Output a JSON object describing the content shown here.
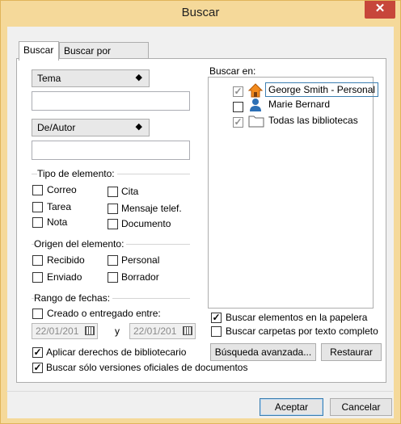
{
  "window": {
    "title": "Buscar",
    "close_glyph": "✕",
    "colors": {
      "frame": "#f5d99a",
      "close": "#c7463a",
      "accent": "#3c7fb1"
    }
  },
  "tabs": [
    {
      "label": "Buscar",
      "active": true
    },
    {
      "label": "Buscar por ejemplo",
      "active": false
    }
  ],
  "fields": {
    "field1": {
      "label": "Tema",
      "value": ""
    },
    "field2": {
      "label": "De/Autor",
      "value": ""
    }
  },
  "item_type": {
    "label": "Tipo de elemento:",
    "options": [
      {
        "label": "Correo",
        "checked": false
      },
      {
        "label": "Cita",
        "checked": false
      },
      {
        "label": "Tarea",
        "checked": false
      },
      {
        "label": "Mensaje telef.",
        "checked": false
      },
      {
        "label": "Nota",
        "checked": false
      },
      {
        "label": "Documento",
        "checked": false
      }
    ]
  },
  "origin": {
    "label": "Origen del elemento:",
    "options": [
      {
        "label": "Recibido",
        "checked": false
      },
      {
        "label": "Personal",
        "checked": false
      },
      {
        "label": "Enviado",
        "checked": false
      },
      {
        "label": "Borrador",
        "checked": false
      }
    ]
  },
  "date_range": {
    "label": "Rango de fechas:",
    "created_label": "Creado o entregado entre:",
    "created_checked": false,
    "from": "22/01/201",
    "to": "22/01/201",
    "and_label": "y"
  },
  "options": {
    "librarian_label": "Aplicar derechos de bibliotecario",
    "librarian_checked": true,
    "official_label": "Buscar sólo versiones oficiales de documentos",
    "official_checked": true
  },
  "search_in": {
    "label": "Buscar en:",
    "items": [
      {
        "label": "George Smith - Personal",
        "checked": true,
        "icon": "home-icon"
      },
      {
        "label": "Marie Bernard",
        "checked": false,
        "icon": "user-icon"
      },
      {
        "label": "Todas las bibliotecas",
        "checked": true,
        "icon": "folder-icon"
      }
    ]
  },
  "trash": {
    "label": "Buscar elementos en la papelera",
    "checked": true
  },
  "fulltext": {
    "label": "Buscar carpetas por texto completo",
    "checked": false
  },
  "buttons": {
    "advanced": "Búsqueda avanzada...",
    "restore": "Restaurar",
    "accept": "Aceptar",
    "cancel": "Cancelar"
  }
}
